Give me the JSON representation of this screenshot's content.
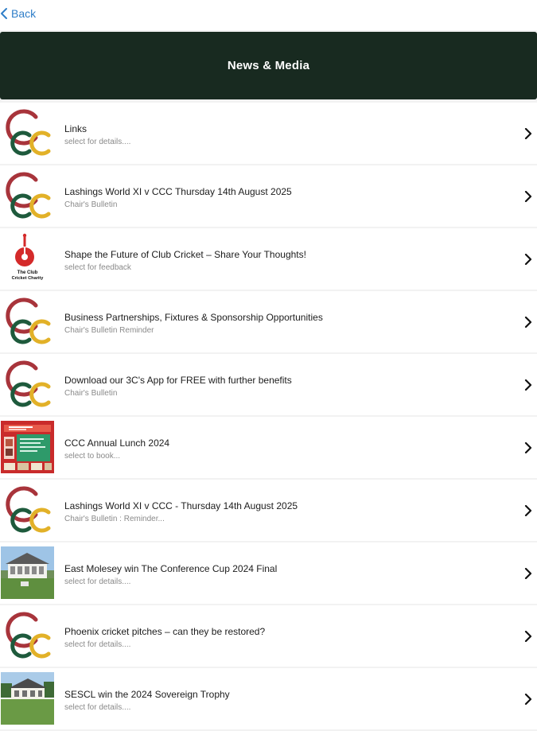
{
  "nav": {
    "back_label": "Back"
  },
  "header": {
    "title": "News & Media"
  },
  "colors": {
    "header_bg": "#182a20",
    "back_link": "#2f7ec8",
    "logo_red": "#a8343b",
    "logo_green": "#1e5a3c",
    "logo_gold": "#e2b128"
  },
  "items": [
    {
      "icon": "ccc-logo",
      "title": "Links",
      "subtitle": "select for details...."
    },
    {
      "icon": "ccc-logo",
      "title": "Lashings World XI v CCC  Thursday 14th August 2025",
      "subtitle": "Chair's Bulletin"
    },
    {
      "icon": "club-cricket-charity-logo",
      "logo_text": "The Club Cricket Charity",
      "title": "Shape the Future of Club Cricket – Share Your Thoughts!",
      "subtitle": "select for feedback"
    },
    {
      "icon": "ccc-logo",
      "title": "Business Partnerships, Fixtures & Sponsorship Opportunities",
      "subtitle": "Chair's Bulletin Reminder"
    },
    {
      "icon": "ccc-logo",
      "title": "Download our 3C's App for FREE with further benefits",
      "subtitle": "Chair's Bulletin"
    },
    {
      "icon": "annual-lunch-poster",
      "title": "CCC Annual Lunch 2024",
      "subtitle": "select to book..."
    },
    {
      "icon": "ccc-logo",
      "title": "Lashings World XI v CCC - Thursday 14th August 2025",
      "subtitle": "Chair's Bulletin : Reminder..."
    },
    {
      "icon": "pavilion-photo",
      "title": "East Molesey win The Conference Cup 2024 Final",
      "subtitle": "select for details...."
    },
    {
      "icon": "ccc-logo",
      "title": "Phoenix cricket pitches – can they be restored?",
      "subtitle": "select for details...."
    },
    {
      "icon": "clubhouse-photo",
      "title": "SESCL win the 2024 Sovereign Trophy",
      "subtitle": "select for details...."
    }
  ]
}
